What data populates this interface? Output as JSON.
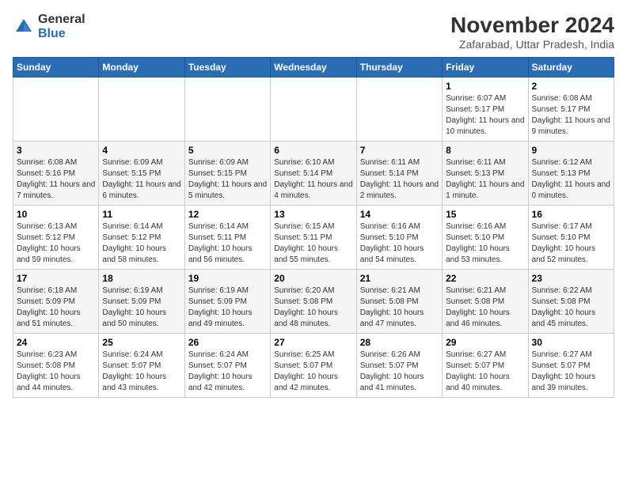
{
  "logo": {
    "general": "General",
    "blue": "Blue"
  },
  "title": "November 2024",
  "subtitle": "Zafarabad, Uttar Pradesh, India",
  "weekdays": [
    "Sunday",
    "Monday",
    "Tuesday",
    "Wednesday",
    "Thursday",
    "Friday",
    "Saturday"
  ],
  "weeks": [
    [
      {
        "day": "",
        "info": ""
      },
      {
        "day": "",
        "info": ""
      },
      {
        "day": "",
        "info": ""
      },
      {
        "day": "",
        "info": ""
      },
      {
        "day": "",
        "info": ""
      },
      {
        "day": "1",
        "info": "Sunrise: 6:07 AM\nSunset: 5:17 PM\nDaylight: 11 hours and 10 minutes."
      },
      {
        "day": "2",
        "info": "Sunrise: 6:08 AM\nSunset: 5:17 PM\nDaylight: 11 hours and 9 minutes."
      }
    ],
    [
      {
        "day": "3",
        "info": "Sunrise: 6:08 AM\nSunset: 5:16 PM\nDaylight: 11 hours and 7 minutes."
      },
      {
        "day": "4",
        "info": "Sunrise: 6:09 AM\nSunset: 5:15 PM\nDaylight: 11 hours and 6 minutes."
      },
      {
        "day": "5",
        "info": "Sunrise: 6:09 AM\nSunset: 5:15 PM\nDaylight: 11 hours and 5 minutes."
      },
      {
        "day": "6",
        "info": "Sunrise: 6:10 AM\nSunset: 5:14 PM\nDaylight: 11 hours and 4 minutes."
      },
      {
        "day": "7",
        "info": "Sunrise: 6:11 AM\nSunset: 5:14 PM\nDaylight: 11 hours and 2 minutes."
      },
      {
        "day": "8",
        "info": "Sunrise: 6:11 AM\nSunset: 5:13 PM\nDaylight: 11 hours and 1 minute."
      },
      {
        "day": "9",
        "info": "Sunrise: 6:12 AM\nSunset: 5:13 PM\nDaylight: 11 hours and 0 minutes."
      }
    ],
    [
      {
        "day": "10",
        "info": "Sunrise: 6:13 AM\nSunset: 5:12 PM\nDaylight: 10 hours and 59 minutes."
      },
      {
        "day": "11",
        "info": "Sunrise: 6:14 AM\nSunset: 5:12 PM\nDaylight: 10 hours and 58 minutes."
      },
      {
        "day": "12",
        "info": "Sunrise: 6:14 AM\nSunset: 5:11 PM\nDaylight: 10 hours and 56 minutes."
      },
      {
        "day": "13",
        "info": "Sunrise: 6:15 AM\nSunset: 5:11 PM\nDaylight: 10 hours and 55 minutes."
      },
      {
        "day": "14",
        "info": "Sunrise: 6:16 AM\nSunset: 5:10 PM\nDaylight: 10 hours and 54 minutes."
      },
      {
        "day": "15",
        "info": "Sunrise: 6:16 AM\nSunset: 5:10 PM\nDaylight: 10 hours and 53 minutes."
      },
      {
        "day": "16",
        "info": "Sunrise: 6:17 AM\nSunset: 5:10 PM\nDaylight: 10 hours and 52 minutes."
      }
    ],
    [
      {
        "day": "17",
        "info": "Sunrise: 6:18 AM\nSunset: 5:09 PM\nDaylight: 10 hours and 51 minutes."
      },
      {
        "day": "18",
        "info": "Sunrise: 6:19 AM\nSunset: 5:09 PM\nDaylight: 10 hours and 50 minutes."
      },
      {
        "day": "19",
        "info": "Sunrise: 6:19 AM\nSunset: 5:09 PM\nDaylight: 10 hours and 49 minutes."
      },
      {
        "day": "20",
        "info": "Sunrise: 6:20 AM\nSunset: 5:08 PM\nDaylight: 10 hours and 48 minutes."
      },
      {
        "day": "21",
        "info": "Sunrise: 6:21 AM\nSunset: 5:08 PM\nDaylight: 10 hours and 47 minutes."
      },
      {
        "day": "22",
        "info": "Sunrise: 6:21 AM\nSunset: 5:08 PM\nDaylight: 10 hours and 46 minutes."
      },
      {
        "day": "23",
        "info": "Sunrise: 6:22 AM\nSunset: 5:08 PM\nDaylight: 10 hours and 45 minutes."
      }
    ],
    [
      {
        "day": "24",
        "info": "Sunrise: 6:23 AM\nSunset: 5:08 PM\nDaylight: 10 hours and 44 minutes."
      },
      {
        "day": "25",
        "info": "Sunrise: 6:24 AM\nSunset: 5:07 PM\nDaylight: 10 hours and 43 minutes."
      },
      {
        "day": "26",
        "info": "Sunrise: 6:24 AM\nSunset: 5:07 PM\nDaylight: 10 hours and 42 minutes."
      },
      {
        "day": "27",
        "info": "Sunrise: 6:25 AM\nSunset: 5:07 PM\nDaylight: 10 hours and 42 minutes."
      },
      {
        "day": "28",
        "info": "Sunrise: 6:26 AM\nSunset: 5:07 PM\nDaylight: 10 hours and 41 minutes."
      },
      {
        "day": "29",
        "info": "Sunrise: 6:27 AM\nSunset: 5:07 PM\nDaylight: 10 hours and 40 minutes."
      },
      {
        "day": "30",
        "info": "Sunrise: 6:27 AM\nSunset: 5:07 PM\nDaylight: 10 hours and 39 minutes."
      }
    ]
  ]
}
